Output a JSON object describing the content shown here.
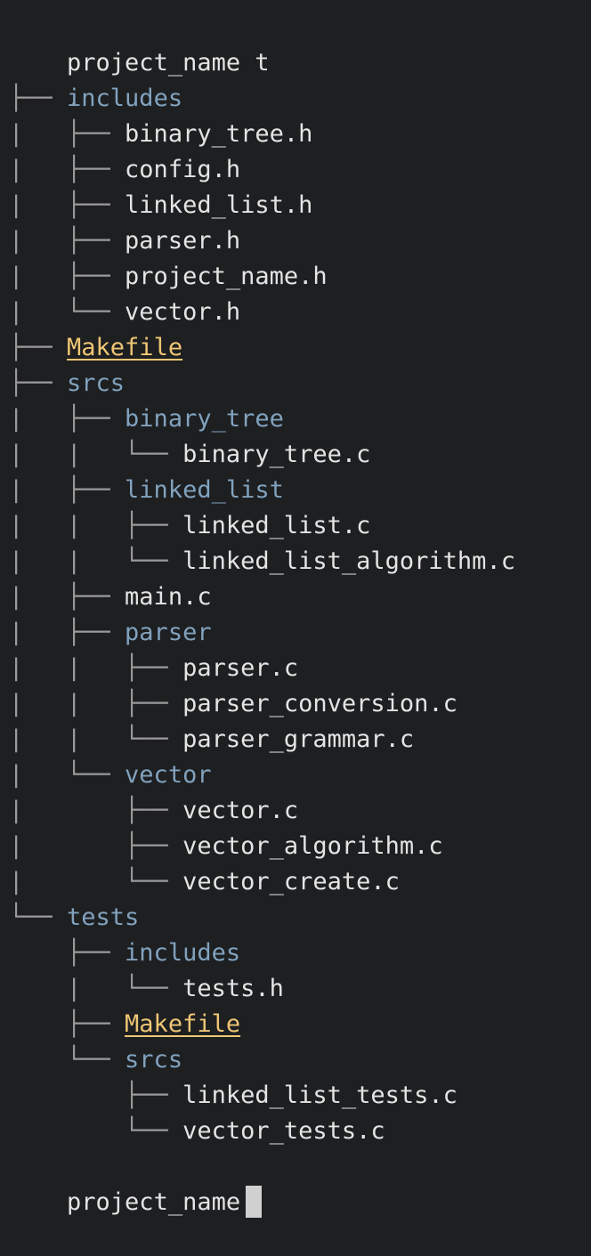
{
  "terminal": {
    "command_line": {
      "prompt": "project_name",
      "command": " t"
    },
    "root_dot": ".",
    "tree": [
      {
        "prefix": "├── ",
        "name": "includes",
        "kind": "dir"
      },
      {
        "prefix": "|   ├── ",
        "name": "binary_tree.h",
        "kind": "file"
      },
      {
        "prefix": "|   ├── ",
        "name": "config.h",
        "kind": "file"
      },
      {
        "prefix": "|   ├── ",
        "name": "linked_list.h",
        "kind": "file"
      },
      {
        "prefix": "|   ├── ",
        "name": "parser.h",
        "kind": "file"
      },
      {
        "prefix": "|   ├── ",
        "name": "project_name.h",
        "kind": "file"
      },
      {
        "prefix": "|   └── ",
        "name": "vector.h",
        "kind": "file"
      },
      {
        "prefix": "├── ",
        "name": "Makefile",
        "kind": "special"
      },
      {
        "prefix": "├── ",
        "name": "srcs",
        "kind": "dir"
      },
      {
        "prefix": "|   ├── ",
        "name": "binary_tree",
        "kind": "dir"
      },
      {
        "prefix": "|   |   └── ",
        "name": "binary_tree.c",
        "kind": "file"
      },
      {
        "prefix": "|   ├── ",
        "name": "linked_list",
        "kind": "dir"
      },
      {
        "prefix": "|   |   ├── ",
        "name": "linked_list.c",
        "kind": "file"
      },
      {
        "prefix": "|   |   └── ",
        "name": "linked_list_algorithm.c",
        "kind": "file"
      },
      {
        "prefix": "|   ├── ",
        "name": "main.c",
        "kind": "file"
      },
      {
        "prefix": "|   ├── ",
        "name": "parser",
        "kind": "dir"
      },
      {
        "prefix": "|   |   ├── ",
        "name": "parser.c",
        "kind": "file"
      },
      {
        "prefix": "|   |   ├── ",
        "name": "parser_conversion.c",
        "kind": "file"
      },
      {
        "prefix": "|   |   └── ",
        "name": "parser_grammar.c",
        "kind": "file"
      },
      {
        "prefix": "|   └── ",
        "name": "vector",
        "kind": "dir"
      },
      {
        "prefix": "|       ├── ",
        "name": "vector.c",
        "kind": "file"
      },
      {
        "prefix": "|       ├── ",
        "name": "vector_algorithm.c",
        "kind": "file"
      },
      {
        "prefix": "|       └── ",
        "name": "vector_create.c",
        "kind": "file"
      },
      {
        "prefix": "└── ",
        "name": "tests",
        "kind": "dir"
      },
      {
        "prefix": "    ├── ",
        "name": "includes",
        "kind": "dir"
      },
      {
        "prefix": "    |   └── ",
        "name": "tests.h",
        "kind": "file"
      },
      {
        "prefix": "    ├── ",
        "name": "Makefile",
        "kind": "special"
      },
      {
        "prefix": "    └── ",
        "name": "srcs",
        "kind": "dir"
      },
      {
        "prefix": "        ├── ",
        "name": "linked_list_tests.c",
        "kind": "file"
      },
      {
        "prefix": "        └── ",
        "name": "vector_tests.c",
        "kind": "file"
      }
    ],
    "prompt_line": {
      "prompt": "project_name"
    },
    "colors": {
      "background": "#1d1f21",
      "text": "#e4e4e4",
      "directory": "#81a2be",
      "special": "#f0c674",
      "tree_lines": "#9a9a9a"
    }
  }
}
